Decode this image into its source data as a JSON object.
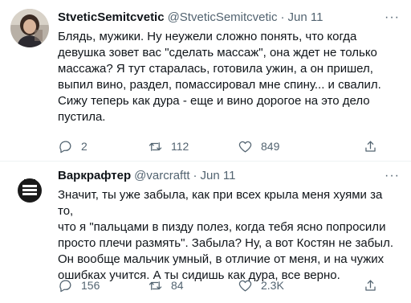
{
  "tweets": [
    {
      "name": "StveticSemitcvetic",
      "handle": "@StveticSemitcvetic",
      "dot": "·",
      "date": "Jun 11",
      "more": "···",
      "text": "Блядь, мужики. Ну неужели сложно понять, что когда\nдевушка зовет вас \"сделать массаж\", она ждет не только\nмассажа? Я тут старалась, готовила ужин, а он пришел,\nвыпил вино, раздел, помассировал мне спину... и свалил.\nСижу теперь как дура - еще и вино дорогое на это дело\nпустила.",
      "replies": "2",
      "retweets": "112",
      "likes": "849",
      "icons": [
        "reply-icon",
        "retweet-icon",
        "like-icon",
        "share-icon"
      ]
    },
    {
      "name": "Варкрафтер",
      "handle": "@varcraftt",
      "dot": "·",
      "date": "Jun 11",
      "more": "···",
      "text": "Значит, ты уже забыла, как при всех крыла меня хуями за то,\nчто я \"пальцами в пизду полез, когда тебя ясно попросили\nпросто плечи размять\". Забыла? Ну, а вот Костян не забыл.\nОн вообще мальчик умный, в отличие от меня, и на чужих\nошибках учится. А ты сидишь как дура, все верно.",
      "replies": "156",
      "retweets": "84",
      "likes": "2.3K",
      "icons": [
        "reply-icon",
        "retweet-icon",
        "like-icon",
        "share-icon"
      ]
    }
  ],
  "colors": {
    "text": "#0f1419",
    "secondary": "#536471",
    "divider": "#eff3f4"
  }
}
